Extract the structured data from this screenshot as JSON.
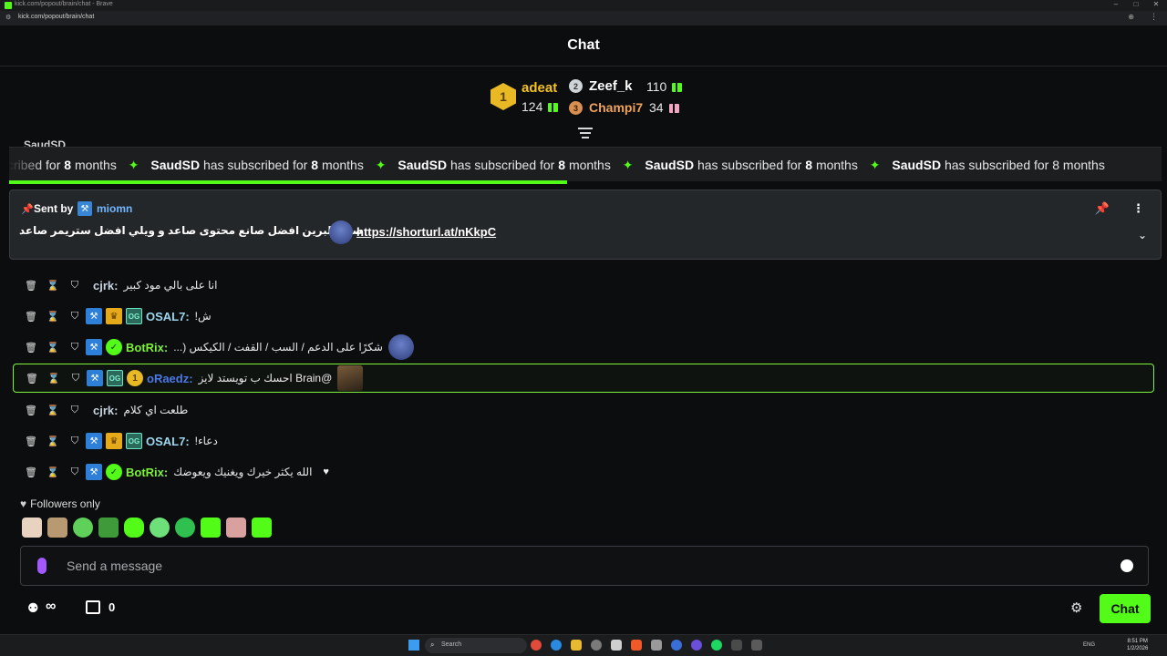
{
  "browser": {
    "window_title": "kick.com/popout/brain/chat - Brave",
    "url": "kick.com/popout/brain/chat"
  },
  "header": {
    "title": "Chat"
  },
  "leaderboard": {
    "first": {
      "rank": "1",
      "name": "adeat",
      "count": "124"
    },
    "second": {
      "rank": "2",
      "name": "Zeef_k",
      "count": "110"
    },
    "third": {
      "rank": "3",
      "name": "Champi7",
      "count": "34"
    }
  },
  "ticker": {
    "peek_name": "SaudSD",
    "lead_fragment": "cribed for",
    "user": "SaudSD",
    "phrase": "has subscribed for",
    "months": "8",
    "unit": "months",
    "tail_fragment": "8 months"
  },
  "pinned": {
    "sent_by_label": "Sent by",
    "sender": "miomn",
    "message": "صوت  لبرين افضل صانع محتوى صاعد و ويلي افضل ستريمر صاعد",
    "link": "https://shorturl.at/nKkpC"
  },
  "messages": [
    {
      "user": "cjrk:",
      "text": "انا على بالي مود كبير",
      "user_color": "#c7d3de"
    },
    {
      "user": "OSAL7:",
      "text": "ش!",
      "user_color": "#9ed6ee"
    },
    {
      "user": "BotRix:",
      "text": "شكرًا على الدعم / السب / القفت / الكيكس (...",
      "user_color": "#7df03a"
    },
    {
      "user": "oRaedz:",
      "text": "@Brain احسك ب تويستد لايز",
      "user_color": "#4a78e6",
      "gifter_rank": "1"
    },
    {
      "user": "cjrk:",
      "text": "طلعت اي كلام",
      "user_color": "#c7d3de"
    },
    {
      "user": "OSAL7:",
      "text": "دعاء!",
      "user_color": "#9ed6ee"
    },
    {
      "user": "BotRix:",
      "text": "الله يكثر خيرك ويغنيك ويعوضك",
      "user_color": "#7df03a"
    }
  ],
  "badges": {
    "og": "OG"
  },
  "followers_only": "Followers only",
  "input": {
    "placeholder": "Send a message"
  },
  "footer": {
    "points": "∞",
    "gift_count": "0",
    "chat_button": "Chat"
  },
  "taskbar": {
    "search_label": "Search",
    "lang": "ENG",
    "time": "8:51 PM",
    "date": "1/2/2026"
  },
  "colors": {
    "accent": "#53fc18",
    "background": "#0b0d0e",
    "gold": "#f4c21a"
  }
}
